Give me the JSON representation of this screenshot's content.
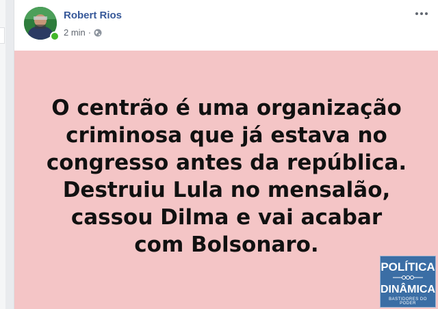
{
  "post": {
    "author": "Robert Rios",
    "timestamp": "2 min",
    "privacy_icon": "globe-icon",
    "options_icon": "more-options-icon",
    "status_text": "O centrão é uma organização\ncriminosa que já estava no\ncongresso antes da república.\nDestruiu Lula no mensalão,\ncassou Dilma e vai acabar\ncom Bolsonaro.",
    "background_color": "#f4c5c6"
  },
  "watermark": {
    "line1": "POLÍTICA",
    "line2": "DINÂMICA",
    "tagline": "BASTIDORES DO PODER"
  }
}
